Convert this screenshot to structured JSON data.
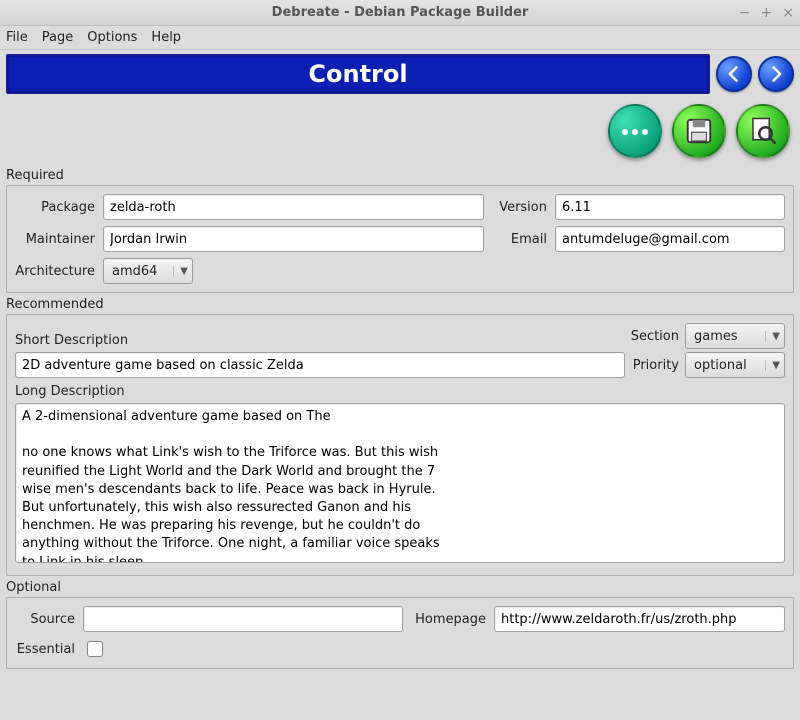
{
  "window": {
    "title": "Debreate - Debian Package Builder"
  },
  "menu": {
    "file": "File",
    "page": "Page",
    "options": "Options",
    "help": "Help"
  },
  "banner": {
    "title": "Control"
  },
  "sections": {
    "required_label": "Required",
    "recommended_label": "Recommended",
    "optional_label": "Optional"
  },
  "required": {
    "package_label": "Package",
    "package_value": "zelda-roth",
    "version_label": "Version",
    "version_value": "6.11",
    "maintainer_label": "Maintainer",
    "maintainer_value": "Jordan Irwin",
    "email_label": "Email",
    "email_value": "antumdeluge@gmail.com",
    "architecture_label": "Architecture",
    "architecture_value": "amd64"
  },
  "recommended": {
    "section_label": "Section",
    "section_value": "games",
    "short_desc_label": "Short Description",
    "short_desc_value": "2D adventure game based on classic Zelda",
    "priority_label": "Priority",
    "priority_value": "optional",
    "long_desc_label": "Long Description",
    "long_desc_value": "A 2-dimensional adventure game based on The\n\nno one knows what Link's wish to the Triforce was. But this wish\nreunified the Light World and the Dark World and brought the 7\nwise men's descendants back to life. Peace was back in Hyrule.\nBut unfortunately, this wish also ressurected Ganon and his\nhenchmen. He was preparing his revenge, but he couldn't do\nanything without the Triforce. One night, a familiar voice speaks\nto Link in his sleep..."
  },
  "optional": {
    "source_label": "Source",
    "source_value": "",
    "homepage_label": "Homepage",
    "homepage_value": "http://www.zeldaroth.fr/us/zroth.php",
    "essential_label": "Essential"
  }
}
